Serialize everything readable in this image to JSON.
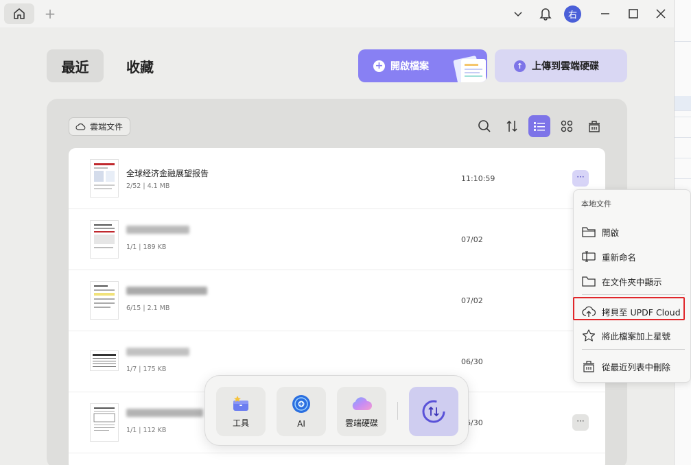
{
  "titlebar": {
    "avatar_initial": "右"
  },
  "tabs": {
    "recent": "最近",
    "favorites": "收藏"
  },
  "actions": {
    "open_file": "開啟檔案",
    "upload_cloud": "上傳到雲端硬碟"
  },
  "toolbar": {
    "cloud_docs_chip": "雲端文件"
  },
  "files": [
    {
      "name": "全球经济金融展望报告",
      "meta": "2/52 | 4.1 MB",
      "date": "11:10:59",
      "name_blurred": false
    },
    {
      "name": "",
      "meta": "1/1 | 189 KB",
      "date": "07/02",
      "name_blurred": true
    },
    {
      "name": "",
      "meta": "6/15 | 2.1 MB",
      "date": "07/02",
      "name_blurred": true
    },
    {
      "name": "",
      "meta": "1/7 | 175 KB",
      "date": "06/30",
      "name_blurred": true
    },
    {
      "name": "",
      "meta": "1/1 | 112 KB",
      "date": "06/30",
      "name_blurred": true
    }
  ],
  "context_menu": {
    "title": "本地文件",
    "items": [
      {
        "label": "開啟",
        "icon": "folder-open-icon"
      },
      {
        "label": "重新命名",
        "icon": "rename-icon"
      },
      {
        "label": "在文件夾中顯示",
        "icon": "folder-icon"
      },
      {
        "label": "拷貝至 UPDF Cloud",
        "icon": "cloud-upload-icon",
        "highlighted": true
      },
      {
        "label": "將此檔案加上星號",
        "icon": "star-icon"
      },
      {
        "label": "從最近列表中刪除",
        "icon": "trash-icon"
      }
    ]
  },
  "dock": {
    "tools": "工具",
    "ai": "AI",
    "cloud_drive": "雲端硬碟"
  },
  "colors": {
    "accent": "#7d74e8",
    "open_button": "#8880f3",
    "highlight_border": "#e0262a",
    "avatar": "#4a5fd8"
  }
}
